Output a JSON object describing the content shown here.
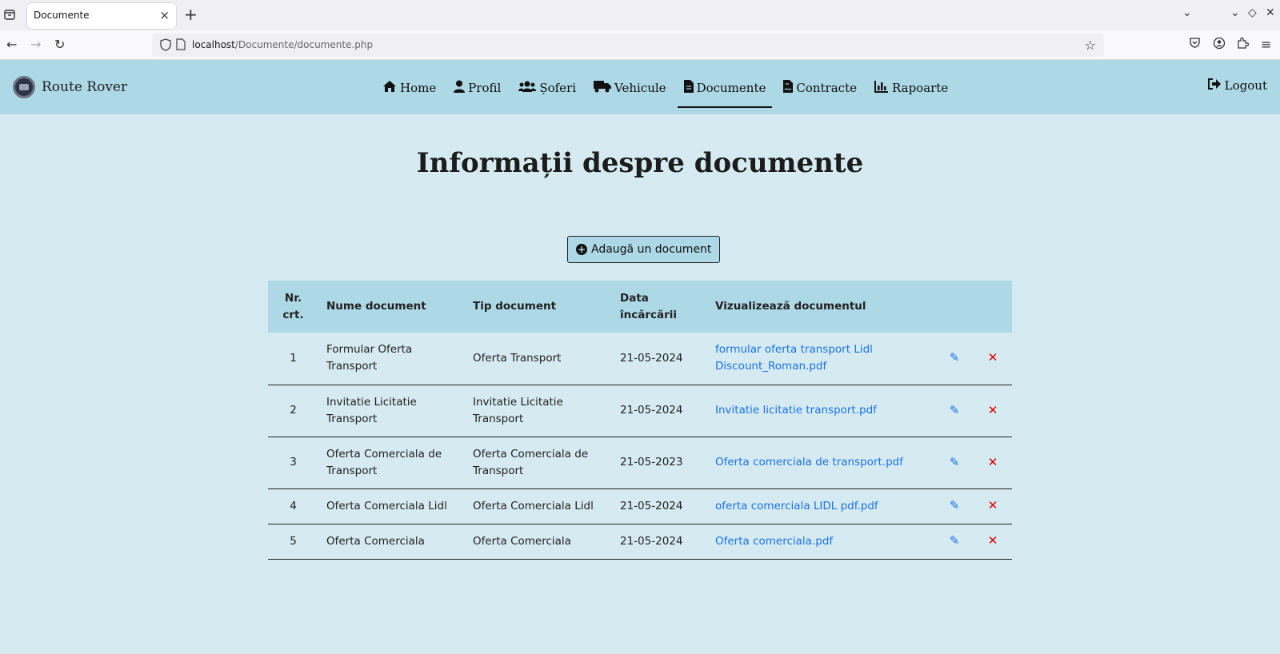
{
  "browser": {
    "tab_title": "Documente",
    "url_host": "localhost",
    "url_path": "/Documente/documente.php"
  },
  "site": {
    "brand": "Route Rover",
    "menu": [
      {
        "label": "Home",
        "icon": "home-icon"
      },
      {
        "label": "Profil",
        "icon": "user-icon"
      },
      {
        "label": "Șoferi",
        "icon": "users-icon"
      },
      {
        "label": "Vehicule",
        "icon": "truck-icon"
      },
      {
        "label": "Documente",
        "icon": "file-icon",
        "active": true
      },
      {
        "label": "Contracte",
        "icon": "file-contract-icon"
      },
      {
        "label": "Rapoarte",
        "icon": "chart-icon"
      }
    ],
    "logout": "Logout"
  },
  "main": {
    "title": "Informații despre documente",
    "add_button": "Adaugă un document",
    "columns": [
      "Nr. crt.",
      "Nume document",
      "Tip document",
      "Data încărcării",
      "Vizualizează documentul"
    ],
    "rows": [
      {
        "nr": "1",
        "nume": "Formular Oferta Transport",
        "tip": "Oferta Transport",
        "data": "21-05-2024",
        "fisier": "formular oferta transport Lidl Discount_Roman.pdf"
      },
      {
        "nr": "2",
        "nume": "Invitatie Licitatie Transport",
        "tip": "Invitatie Licitatie Transport",
        "data": "21-05-2024",
        "fisier": "Invitatie licitatie transport.pdf"
      },
      {
        "nr": "3",
        "nume": "Oferta Comerciala de Transport",
        "tip": "Oferta Comerciala de Transport",
        "data": "21-05-2023",
        "fisier": "Oferta comerciala de transport.pdf"
      },
      {
        "nr": "4",
        "nume": "Oferta Comerciala Lidl",
        "tip": "Oferta Comerciala Lidl",
        "data": "21-05-2024",
        "fisier": "oferta comerciala LIDL pdf.pdf"
      },
      {
        "nr": "5",
        "nume": "Oferta Comerciala",
        "tip": "Oferta Comerciala",
        "data": "21-05-2024",
        "fisier": "Oferta comerciala.pdf"
      }
    ]
  },
  "colors": {
    "header_bg": "#add8e6",
    "page_bg": "#d5eaf1",
    "link": "#1a73e8",
    "delete": "#e00000"
  }
}
